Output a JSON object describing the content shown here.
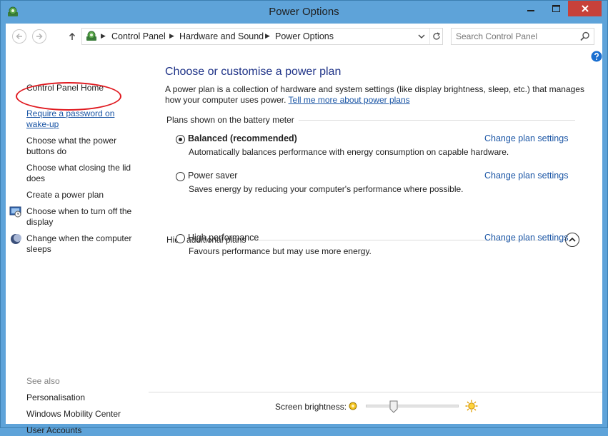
{
  "window": {
    "title": "Power Options",
    "app_icon": "control-panel-icon",
    "controls": [
      "minimize-icon",
      "maximize-icon",
      "close-icon"
    ],
    "close_color": "#c7413a",
    "frame_color": "#5ea3d9"
  },
  "address_bar": {
    "crumbs": [
      "Control Panel",
      "Hardware and Sound",
      "Power Options"
    ]
  },
  "search": {
    "placeholder": "Search Control Panel"
  },
  "sidebar": {
    "items": [
      {
        "label": "Control Panel Home"
      },
      {
        "label": "Require a password on wake-up",
        "active": true
      },
      {
        "label": "Choose what the power buttons do"
      },
      {
        "label": "Choose what closing the lid does"
      },
      {
        "label": "Create a power plan"
      },
      {
        "label": "Choose when to turn off the display",
        "icon": "display-schedule-icon"
      },
      {
        "label": "Change when the computer sleeps",
        "icon": "moon-icon"
      }
    ],
    "see_also_label": "See also",
    "see_also": [
      "Personalisation",
      "Windows Mobility Center",
      "User Accounts"
    ]
  },
  "main": {
    "heading": "Choose or customise a power plan",
    "intro": "A power plan is a collection of hardware and system settings (like display brightness, sleep, etc.) that manages how your computer uses power.",
    "intro_link": "Tell me more about power plans",
    "battery_group_label": "Plans shown on the battery meter",
    "hidden_group_label": "Hide additional plans",
    "plans": [
      {
        "name": "Balanced (recommended)",
        "description": "Automatically balances performance with energy consumption on capable hardware.",
        "selected": true,
        "change_label": "Change plan settings"
      },
      {
        "name": "Power saver",
        "description": "Saves energy by reducing your computer's performance where possible.",
        "selected": false,
        "change_label": "Change plan settings"
      },
      {
        "name": "High performance",
        "description": "Favours performance but may use more energy.",
        "selected": false,
        "change_label": "Change plan settings"
      }
    ]
  },
  "footer": {
    "brightness_label": "Screen brightness:",
    "brightness_level": 0.3
  }
}
